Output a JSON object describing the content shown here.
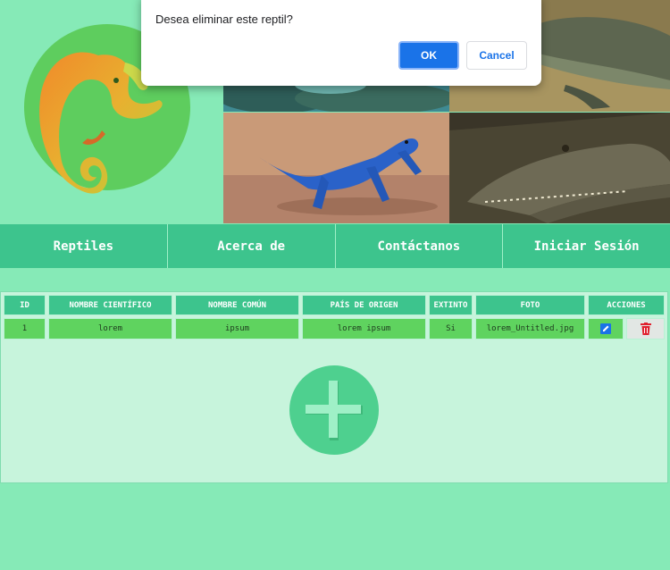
{
  "nav": {
    "items": [
      "Reptiles",
      "Acerca de",
      "Contáctanos",
      "Iniciar Sesión"
    ]
  },
  "table": {
    "headers": [
      "ID",
      "NOMBRE CIENTÍFICO",
      "NOMBRE COMÚN",
      "PAÍS DE ORIGEN",
      "EXTINTO",
      "FOTO",
      "ACCIONES"
    ],
    "rows": [
      {
        "id": "1",
        "cientifico": "lorem",
        "comun": "ipsum",
        "pais": "lorem ipsum",
        "extinto": "Si",
        "foto": "lorem_Untitled.jpg"
      }
    ]
  },
  "icons": {
    "logo": "lizard-logo",
    "edit": "edit-icon",
    "delete": "trash-icon",
    "add": "plus-icon"
  },
  "dialog": {
    "message": "Desea eliminar este reptil?",
    "ok_label": "OK",
    "cancel_label": "Cancel"
  },
  "colors": {
    "background": "#86eab7",
    "nav": "#3dc48d",
    "row": "#5fd35f",
    "primary_button": "#1a73e8",
    "delete_icon": "#e0202e"
  }
}
